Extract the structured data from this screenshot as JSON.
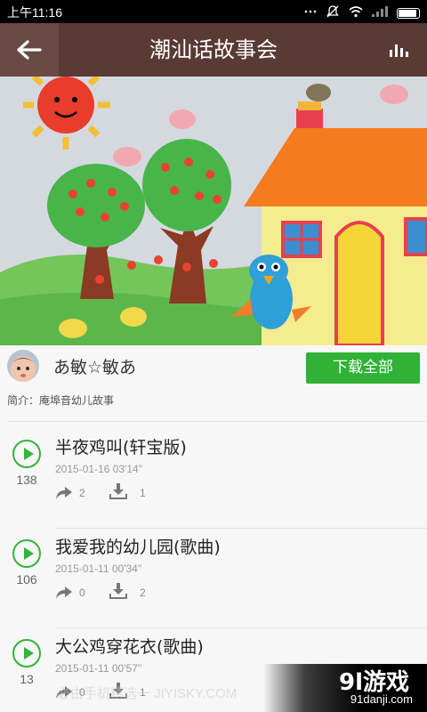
{
  "status_bar": {
    "time": "上午11:16",
    "icons": [
      "more-icon",
      "mute-icon",
      "wifi-icon",
      "signal-icon",
      "battery-icon"
    ]
  },
  "title_bar": {
    "title": "潮汕话故事会",
    "back_icon": "back-arrow-icon",
    "stats_icon": "bar-chart-icon",
    "color": "#5a3a35"
  },
  "album": {
    "author": "あ敏☆敏あ",
    "download_all_label": "下载全部",
    "intro": "简介：庵埠音幼儿故事",
    "accent_color": "#2fb235"
  },
  "tracks": [
    {
      "name": "半夜鸡叫(轩宝版)",
      "date": "2015-01-16",
      "duration": "03'14\"",
      "plays": "138",
      "shares": "2",
      "downloads": "1"
    },
    {
      "name": "我爱我的幼儿园(歌曲)",
      "date": "2015-01-11",
      "duration": "00'34\"",
      "plays": "106",
      "shares": "0",
      "downloads": "2"
    },
    {
      "name": "大公鸡穿花衣(歌曲)",
      "date": "2015-01-11",
      "duration": "00'57\"",
      "plays": "13",
      "shares": "0",
      "downloads": "1"
    }
  ],
  "watermark": {
    "brand": "9l游戏",
    "site": "91danji.com",
    "overlay_text": "必由手机精选一 JIYISKY.COM"
  }
}
